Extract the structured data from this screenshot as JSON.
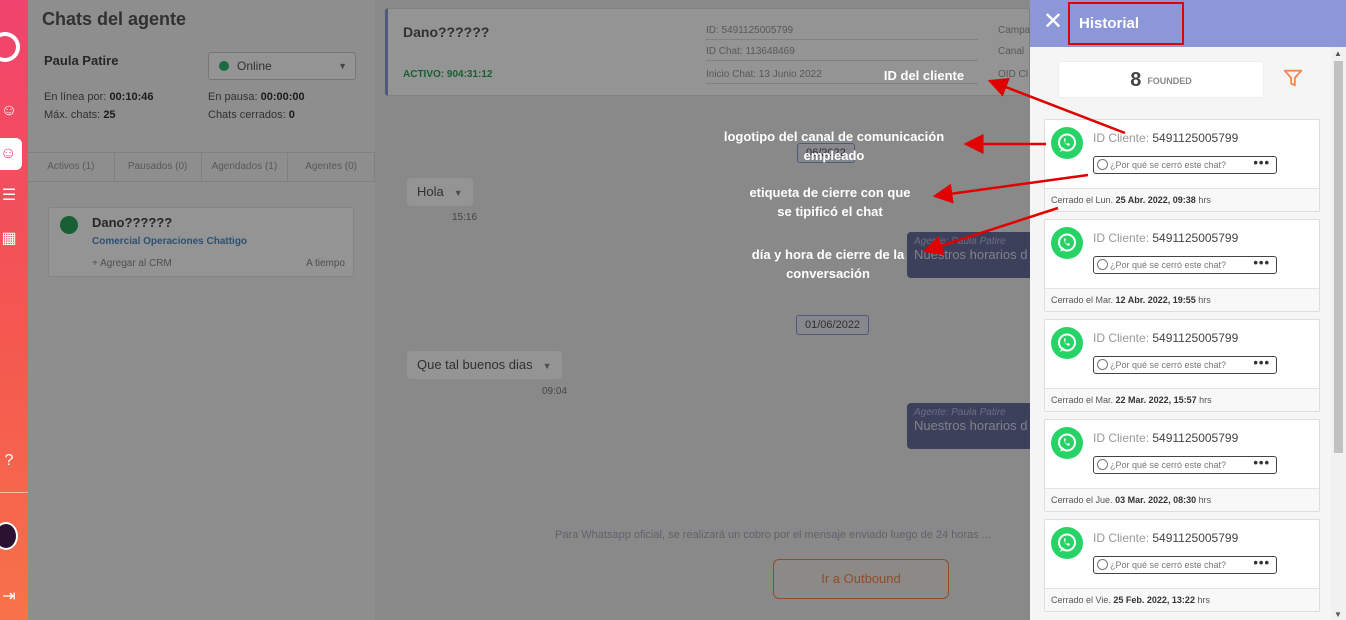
{
  "agent": {
    "title": "Chats del agente",
    "name": "Paula Patire",
    "status": "Online",
    "online_for_label": "En línea por:",
    "online_for": "00:10:46",
    "paused_label": "En pausa:",
    "paused": "00:00:00",
    "max_chats_label": "Máx. chats:",
    "max_chats": "25",
    "closed_chats_label": "Chats cerrados:",
    "closed_chats": "0",
    "tabs": [
      "Activos (1)",
      "Pausados (0)",
      "Agendados (1)",
      "Agentes (0)"
    ],
    "chat_item": {
      "name": "Dano??????",
      "company": "Comercial Operaciones Chattigo",
      "crm": "+ Agregar al CRM",
      "status": "A tiempo"
    }
  },
  "chat": {
    "contact": "Dano??????",
    "active": "ACTIVO: 904:31:12",
    "id_line": "ID: 5491125005799",
    "chat_id_line": "ID Chat: 113648469",
    "start_line": "Inicio Chat: 13 Junio 2022",
    "camp_label": "Campa",
    "canal_label": "Canal",
    "oid_label": "OID Cl",
    "date1": "06/2022",
    "msg1": "Hola",
    "time1": "15:16",
    "date2": "01/06/2022",
    "msg2": "Que tal buenos dias",
    "time2": "09:04",
    "agent_label": "Agente: Paula Patire",
    "agent_msg": "Nuestros horarios d",
    "footer_note": "Para Whatsapp oficial, se realizará un cobro por el mensaje enviado luego de 24 horas ...",
    "outbound_button": "Ir a Outbound"
  },
  "annotations": {
    "id_cliente": "ID del cliente",
    "logo_line1": "logotipo del canal de comunicación",
    "logo_line2": "empleado",
    "tag_line1": "etiqueta de cierre con que",
    "tag_line2": "se tipificó el chat",
    "date_line1": "día y hora de cierre de la",
    "date_line2": "conversación"
  },
  "historial": {
    "title": "Historial",
    "count": "8",
    "count_label": "FOUNDED",
    "tag_placeholder": "¿Por qué se cerró este chat?",
    "id_label": "ID Cliente:",
    "cards": [
      {
        "id": "5491125005799",
        "closed_prefix": "Cerrado el Lun.",
        "closed_date": "25 Abr. 2022, 09:38",
        "suffix": "hrs"
      },
      {
        "id": "5491125005799",
        "closed_prefix": "Cerrado el Mar.",
        "closed_date": "12 Abr. 2022, 19:55",
        "suffix": "hrs"
      },
      {
        "id": "5491125005799",
        "closed_prefix": "Cerrado el Mar.",
        "closed_date": "22 Mar. 2022, 15:57",
        "suffix": "hrs"
      },
      {
        "id": "5491125005799",
        "closed_prefix": "Cerrado el Jue.",
        "closed_date": "03 Mar. 2022, 08:30",
        "suffix": "hrs"
      },
      {
        "id": "5491125005799",
        "closed_prefix": "Cerrado el Vie.",
        "closed_date": "25 Feb. 2022, 13:22",
        "suffix": "hrs"
      }
    ]
  },
  "colors": {
    "header": "#8c97d8",
    "whatsapp": "#25d366",
    "accent": "#f4874b",
    "annotation": "#e00000"
  }
}
